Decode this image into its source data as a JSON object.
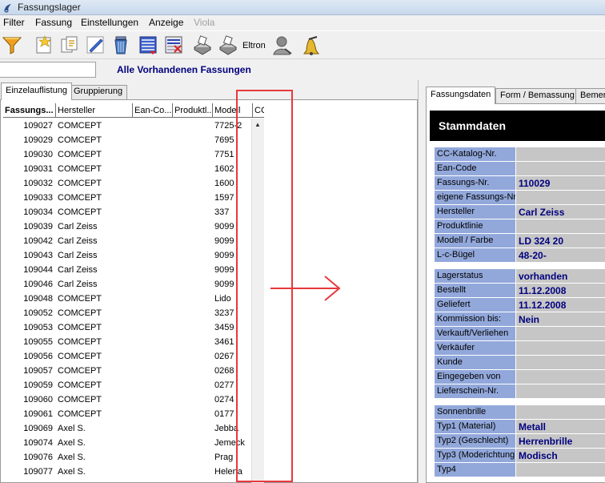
{
  "window": {
    "title": "Fassungslager"
  },
  "menu": [
    {
      "label": "Filter",
      "disabled": false
    },
    {
      "label": "Fassung",
      "disabled": false
    },
    {
      "label": "Einstellungen",
      "disabled": false
    },
    {
      "label": "Anzeige",
      "disabled": false
    },
    {
      "label": "Viola",
      "disabled": true
    }
  ],
  "toolbar": {
    "icons": [
      "filter-funnel-icon",
      "new-frame-icon",
      "copy-frame-icon",
      "edit-pencil-icon",
      "trash-bin-icon",
      "list-view-icon",
      "list-delete-icon",
      "scanner-icon",
      "scanner-2-icon",
      "user-icon",
      "bell-icon"
    ],
    "eltron_label": "Eltron"
  },
  "search": {
    "value": ""
  },
  "list_title": "Alle Vorhandenen Fassungen",
  "left_tabs": [
    "Einzelauflistung",
    "Gruppierung"
  ],
  "grid": {
    "columns": [
      "Fassungs...",
      "Hersteller",
      "Ean-Co...",
      "Produktl...",
      "Modell",
      "CC"
    ],
    "rows": [
      [
        "109027",
        "COMCEPT",
        "7725-2"
      ],
      [
        "109029",
        "COMCEPT",
        "7695"
      ],
      [
        "109030",
        "COMCEPT",
        "7751"
      ],
      [
        "109031",
        "COMCEPT",
        "1602"
      ],
      [
        "109032",
        "COMCEPT",
        "1600"
      ],
      [
        "109033",
        "COMCEPT",
        "1597"
      ],
      [
        "109034",
        "COMCEPT",
        "337"
      ],
      [
        "109039",
        "Carl Zeiss",
        "9099"
      ],
      [
        "109042",
        "Carl Zeiss",
        "9099"
      ],
      [
        "109043",
        "Carl Zeiss",
        "9099"
      ],
      [
        "109044",
        "Carl Zeiss",
        "9099"
      ],
      [
        "109046",
        "Carl Zeiss",
        "9099"
      ],
      [
        "109048",
        "COMCEPT",
        "Lido"
      ],
      [
        "109052",
        "COMCEPT",
        "3237"
      ],
      [
        "109053",
        "COMCEPT",
        "3459"
      ],
      [
        "109055",
        "COMCEPT",
        "3461"
      ],
      [
        "109056",
        "COMCEPT",
        "0267"
      ],
      [
        "109057",
        "COMCEPT",
        "0268"
      ],
      [
        "109059",
        "COMCEPT",
        "0277"
      ],
      [
        "109060",
        "COMCEPT",
        "0274"
      ],
      [
        "109061",
        "COMCEPT",
        "0177"
      ],
      [
        "109069",
        "Axel S.",
        "Jebba"
      ],
      [
        "109074",
        "Axel S.",
        "Jemeck"
      ],
      [
        "109076",
        "Axel S.",
        "Prag"
      ],
      [
        "109077",
        "Axel S.",
        "Helena"
      ]
    ]
  },
  "right_tabs": [
    "Fassungsdaten",
    "Form / Bemassung",
    "Bemer"
  ],
  "details": {
    "header": "Stammdaten",
    "groups": [
      [
        {
          "label": "CC-Katalog-Nr.",
          "value": ""
        },
        {
          "label": "Ean-Code",
          "value": ""
        },
        {
          "label": "Fassungs-Nr.",
          "value": "110029"
        },
        {
          "label": "eigene Fassungs-Nr.",
          "value": ""
        },
        {
          "label": "Hersteller",
          "value": "Carl Zeiss"
        },
        {
          "label": "Produktlinie",
          "value": ""
        },
        {
          "label": "Modell / Farbe",
          "value": "LD  324  20"
        },
        {
          "label": "L-c-Bügel",
          "value": "48-20-"
        }
      ],
      [
        {
          "label": "Lagerstatus",
          "value": "vorhanden"
        },
        {
          "label": "Bestellt",
          "value": "11.12.2008"
        },
        {
          "label": "Geliefert",
          "value": "11.12.2008"
        },
        {
          "label": "Kommission bis:",
          "value": "Nein"
        },
        {
          "label": "Verkauft/Verliehen",
          "value": ""
        },
        {
          "label": "Verkäufer",
          "value": ""
        },
        {
          "label": "Kunde",
          "value": ""
        },
        {
          "label": "Eingegeben von",
          "value": ""
        },
        {
          "label": "Lieferschein-Nr.",
          "value": ""
        }
      ],
      [
        {
          "label": "Sonnenbrille",
          "value": ""
        },
        {
          "label": "Typ1 (Material)",
          "value": "Metall"
        },
        {
          "label": "Typ2 (Geschlecht)",
          "value": "Herrenbrille"
        },
        {
          "label": "Typ3 (Moderichtung)",
          "value": "Modisch"
        },
        {
          "label": "Typ4",
          "value": ""
        }
      ]
    ]
  }
}
